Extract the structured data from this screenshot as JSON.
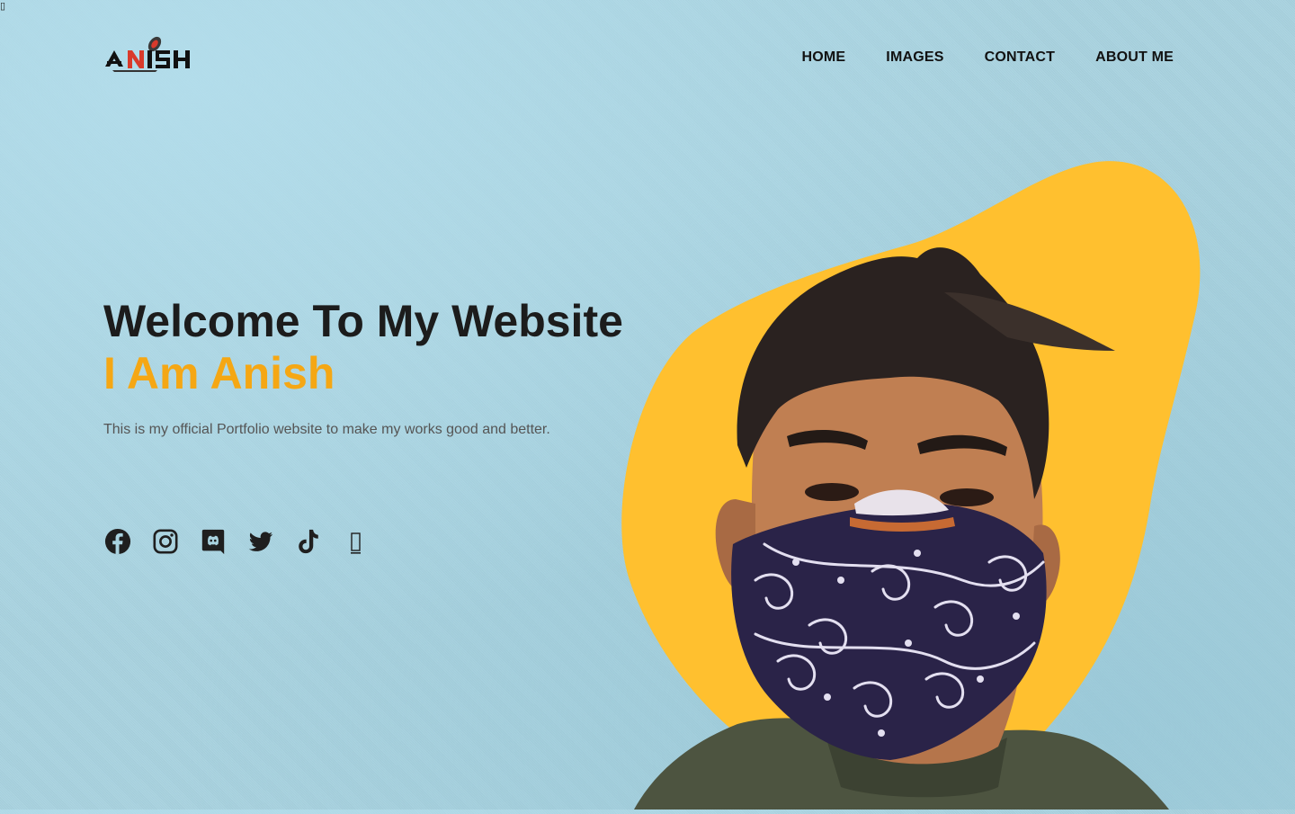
{
  "topbar": {
    "corner_glyph": "▯"
  },
  "logo": {
    "text": "ANISH",
    "icon": "rocket-logo-icon"
  },
  "nav": {
    "items": [
      {
        "label": "HOME"
      },
      {
        "label": "IMAGES"
      },
      {
        "label": "CONTACT"
      },
      {
        "label": "ABOUT ME"
      }
    ]
  },
  "hero": {
    "title": "Welcome To My Website",
    "subtitle": "I Am Anish",
    "description": "This is my official Portfolio website to make my works good and better."
  },
  "socials": [
    {
      "icon": "facebook-icon"
    },
    {
      "icon": "instagram-icon"
    },
    {
      "icon": "discord-icon"
    },
    {
      "icon": "twitter-icon"
    },
    {
      "icon": "tiktok-icon"
    },
    {
      "icon": "missing-glyph-icon"
    }
  ],
  "colors": {
    "background": "#a9d3e0",
    "accent": "#f5a714",
    "blob": "#ffc02f",
    "heading": "#1c1c1c",
    "text": "#555555"
  }
}
